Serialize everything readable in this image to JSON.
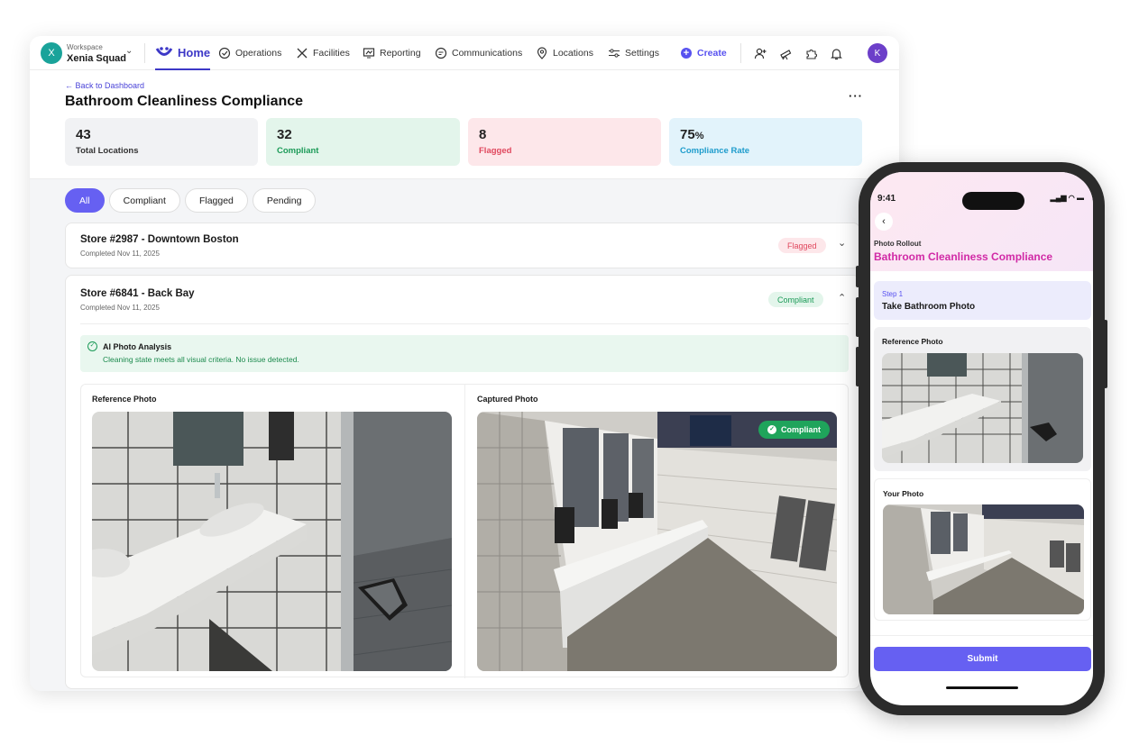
{
  "workspace": {
    "avatar": "X",
    "label": "Workspace",
    "name": "Xenia Squad"
  },
  "nav": {
    "home": "Home",
    "items": [
      "Operations",
      "Facilities",
      "Reporting",
      "Communications",
      "Locations",
      "Settings"
    ],
    "create": "Create",
    "user_avatar": "K"
  },
  "header": {
    "back": "Back to Dashboard",
    "title": "Bathroom Cleanliness Compliance",
    "more": "···"
  },
  "stats": [
    {
      "value": "43",
      "label": "Total Locations",
      "bg": "#f1f2f4",
      "color": "#333333"
    },
    {
      "value": "32",
      "label": "Compliant",
      "bg": "#e3f5eb",
      "color": "#1b9a57"
    },
    {
      "value": "8",
      "label": "Flagged",
      "bg": "#fde7ea",
      "color": "#e0475d"
    },
    {
      "value": "75",
      "unit": "%",
      "label": "Compliance Rate",
      "bg": "#e2f3fb",
      "color": "#1e9ccc"
    }
  ],
  "filters": [
    "All",
    "Compliant",
    "Flagged",
    "Pending"
  ],
  "stores": [
    {
      "title": "Store #2987 - Downtown Boston",
      "date": "Completed Nov 11, 2025",
      "status": "Flagged"
    },
    {
      "title": "Store #6841 - Back Bay",
      "date": "Completed Nov 11, 2025",
      "status": "Compliant"
    }
  ],
  "ai": {
    "title": "AI Photo Analysis",
    "desc": "Cleaning state meets all visual criteria. No issue detected."
  },
  "photos": {
    "reference": "Reference Photo",
    "captured": "Captured Photo",
    "badge": "Compliant"
  },
  "mobile": {
    "time": "9:41",
    "subtitle": "Photo Rollout",
    "title": "Bathroom Cleanliness Compliance",
    "step_label": "Step 1",
    "step_title": "Take Bathroom Photo",
    "reference": "Reference Photo",
    "your_photo": "Your Photo",
    "submit": "Submit"
  },
  "colors": {
    "accent": "#5751f0",
    "brand_pink": "#d12aa6",
    "compliant": "#1b9a57",
    "flagged": "#e0475d"
  }
}
